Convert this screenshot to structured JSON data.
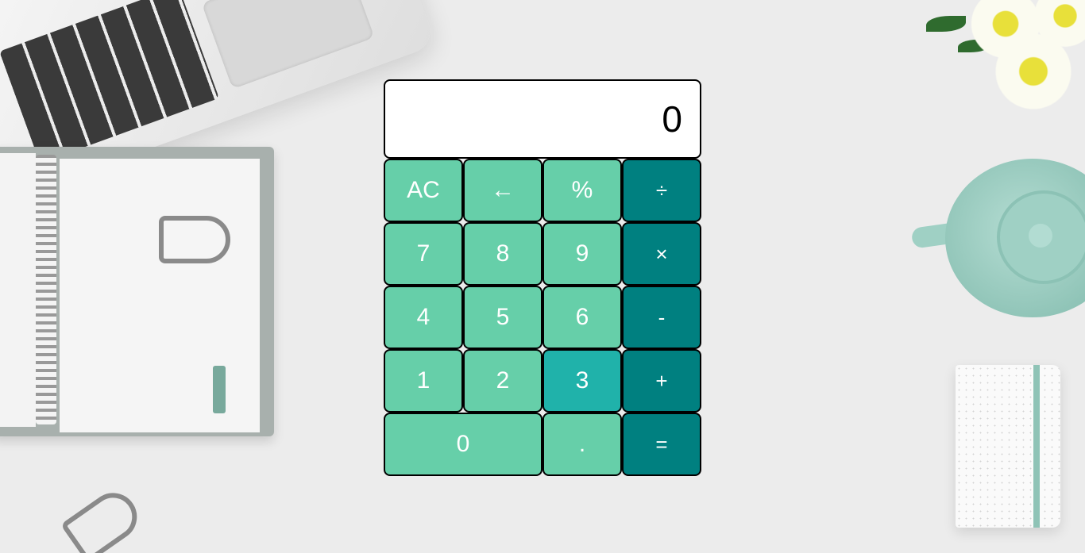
{
  "display": {
    "value": "0"
  },
  "keys": {
    "clear": "AC",
    "backspace": "←",
    "percent": "%",
    "divide": "÷",
    "seven": "7",
    "eight": "8",
    "nine": "9",
    "multiply": "×",
    "four": "4",
    "five": "5",
    "six": "6",
    "subtract": "-",
    "one": "1",
    "two": "2",
    "three": "3",
    "add": "+",
    "zero": "0",
    "decimal": ".",
    "equals": "="
  },
  "colors": {
    "number_key": "#66cfa9",
    "operator_key": "#008080",
    "hovered_key": "#20b2aa",
    "display_bg": "#ffffff"
  }
}
